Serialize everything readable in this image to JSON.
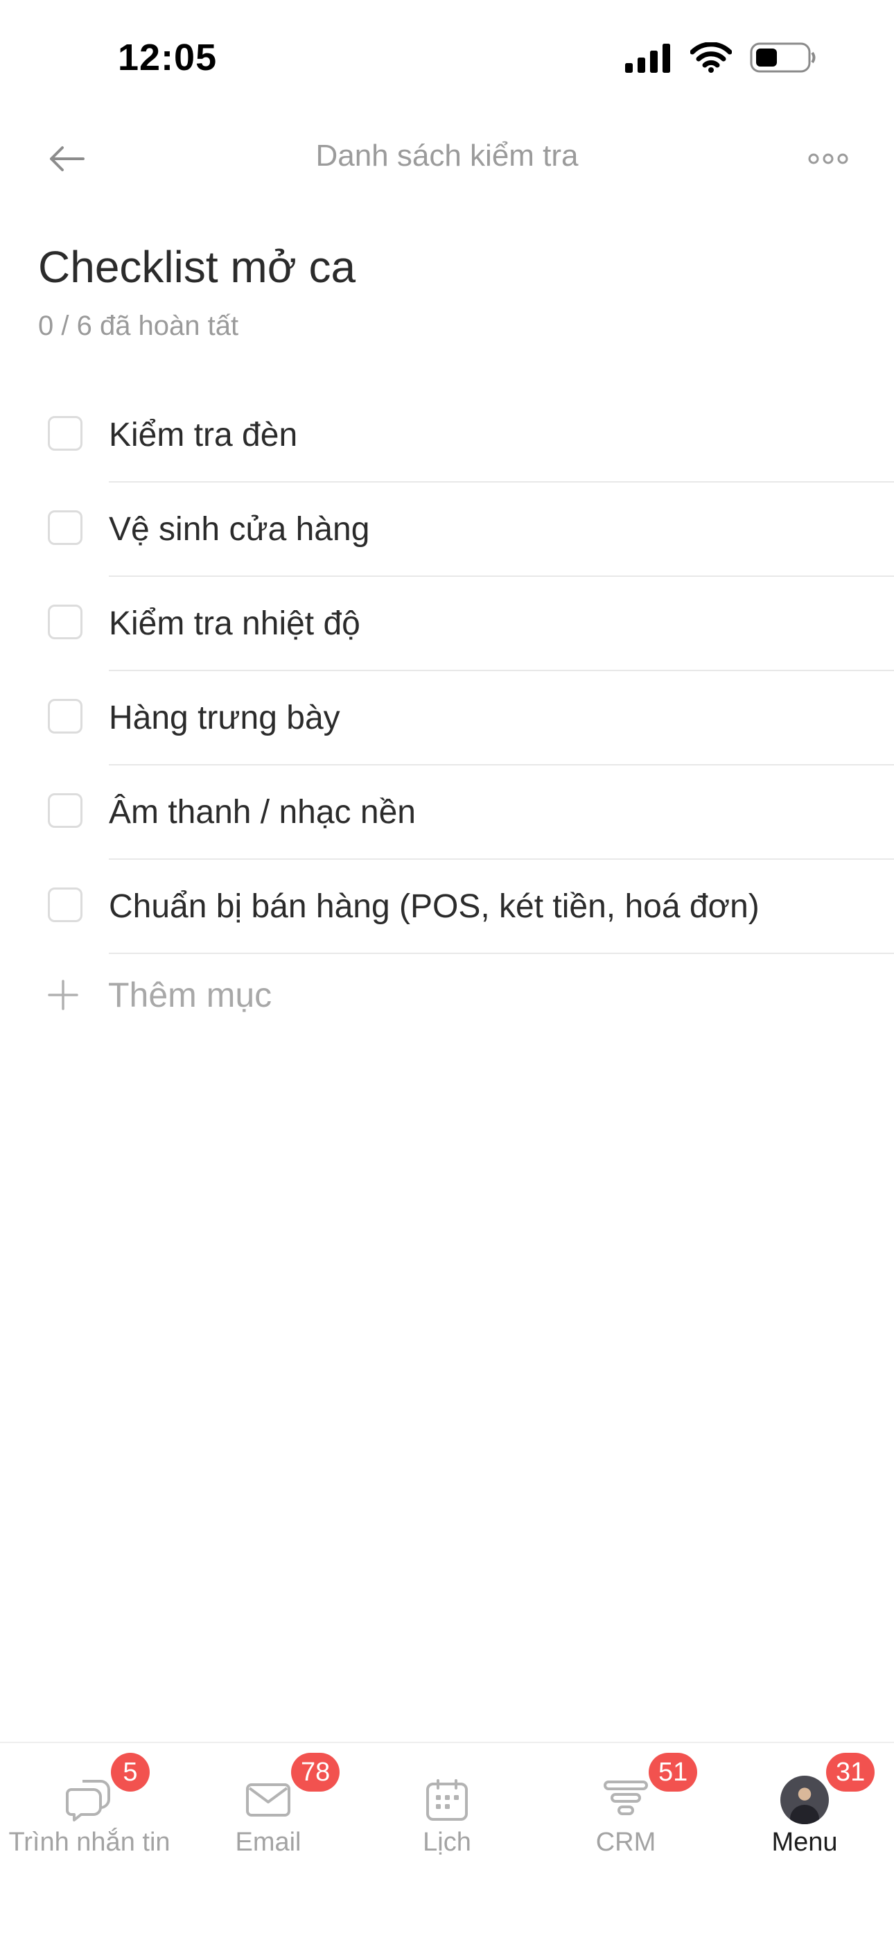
{
  "status_bar": {
    "time": "12:05",
    "icons": [
      "cellular-signal-icon",
      "wifi-icon",
      "battery-icon"
    ]
  },
  "nav": {
    "title": "Danh sách kiểm tra",
    "back_icon": "arrow-left-icon",
    "more_icon": "more-horizontal-icon"
  },
  "checklist": {
    "title": "Checklist mở ca",
    "progress": "0 / 6 đã hoàn tất",
    "items": [
      {
        "label": "Kiểm tra đèn",
        "checked": false
      },
      {
        "label": "Vệ sinh cửa hàng",
        "checked": false
      },
      {
        "label": "Kiểm tra nhiệt độ",
        "checked": false
      },
      {
        "label": "Hàng trưng bày",
        "checked": false
      },
      {
        "label": "Âm thanh / nhạc nền",
        "checked": false
      },
      {
        "label": "Chuẩn bị bán hàng (POS, két tiền, hoá đơn)",
        "checked": false
      }
    ],
    "add_label": "Thêm mục"
  },
  "tab_bar": {
    "tabs": [
      {
        "label": "Trình nhắn tin",
        "badge": "5",
        "icon": "chat-icon",
        "active": false
      },
      {
        "label": "Email",
        "badge": "78",
        "icon": "mail-icon",
        "active": false
      },
      {
        "label": "Lịch",
        "badge": "",
        "icon": "calendar-icon",
        "active": false
      },
      {
        "label": "CRM",
        "badge": "51",
        "icon": "funnel-icon",
        "active": false
      },
      {
        "label": "Menu",
        "badge": "31",
        "icon": "avatar",
        "active": true
      }
    ]
  },
  "colors": {
    "badge": "#f2524f",
    "muted_text": "#9b9b9b",
    "divider": "#e8e8e8"
  }
}
